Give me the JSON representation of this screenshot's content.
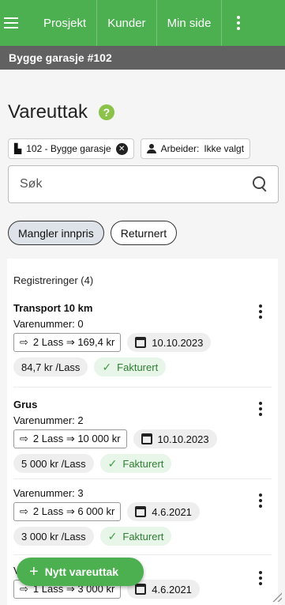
{
  "nav": {
    "items": [
      "Prosjekt",
      "Kunder",
      "Min side"
    ]
  },
  "project": {
    "title": "Bygge garasje #102"
  },
  "page": {
    "title": "Vareuttak",
    "help": "?"
  },
  "filters": {
    "project": "102 - Bygge garasje",
    "worker_label": "Arbeider:",
    "worker_value": "Ikke valgt"
  },
  "search": {
    "placeholder": "Søk"
  },
  "chips": [
    "Mangler innpris",
    "Returnert"
  ],
  "list": {
    "header": "Registreringer (4)",
    "entries": [
      {
        "name": "Transport 10 km",
        "varenummer": "Varenummer: 0",
        "qty": "2 Lass ⇒ 169,4 kr",
        "date": "10.10.2023",
        "price": "84,7 kr /Lass",
        "status": "Fakturert"
      },
      {
        "name": "Grus",
        "varenummer": "Varenummer: 2",
        "qty": "2 Lass ⇒ 10 000 kr",
        "date": "10.10.2023",
        "price": "5 000 kr /Lass",
        "status": "Fakturert"
      },
      {
        "name": "",
        "varenummer": "Varenummer: 3",
        "qty": "2 Lass ⇒ 6 000 kr",
        "date": "4.6.2021",
        "price": "3 000 kr /Lass",
        "status": "Fakturert"
      },
      {
        "name": "",
        "varenummer": "V",
        "qty": "1 Lass ⇒ 3 000 kr",
        "date": "4.6.2021",
        "price": "",
        "status": ""
      }
    ]
  },
  "fab": {
    "label": "Nytt vareuttak",
    "icon": "+"
  },
  "colors": {
    "primary": "#4caf50",
    "project_bar": "#616161"
  }
}
